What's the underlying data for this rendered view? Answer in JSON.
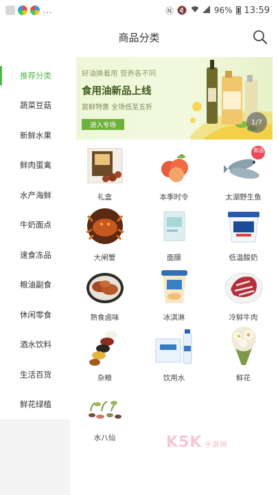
{
  "status_bar": {
    "battery": "96%",
    "time": "13:59",
    "more": "..."
  },
  "header": {
    "title": "商品分类"
  },
  "sidebar": {
    "items": [
      {
        "label": "推荐分类",
        "active": true
      },
      {
        "label": "蔬菜豆菇"
      },
      {
        "label": "新鲜水果"
      },
      {
        "label": "鲜肉蛋禽"
      },
      {
        "label": "水产海鲜"
      },
      {
        "label": "牛奶面点"
      },
      {
        "label": "速食冻品"
      },
      {
        "label": "粮油副食"
      },
      {
        "label": "休闲零食"
      },
      {
        "label": "酒水饮料"
      },
      {
        "label": "生活百货"
      },
      {
        "label": "鲜花绿植"
      }
    ]
  },
  "banner": {
    "subtitle": "好油换着用 营养各不同",
    "title": "食用油新品上线",
    "desc": "尝鲜特惠 全场低至五折",
    "button": "进入专场",
    "pager": "1/7"
  },
  "products": [
    {
      "label": "礼盒",
      "icon": "gift-box-icon"
    },
    {
      "label": "本季时令",
      "icon": "apple-icon"
    },
    {
      "label": "太湖野生鱼",
      "icon": "fish-icon",
      "badge": "新品"
    },
    {
      "label": "大闸蟹",
      "icon": "crab-icon"
    },
    {
      "label": "面膜",
      "icon": "face-mask-icon"
    },
    {
      "label": "低温酸奶",
      "icon": "yogurt-icon"
    },
    {
      "label": "熟食卤味",
      "icon": "braised-meat-icon"
    },
    {
      "label": "冰淇淋",
      "icon": "ice-cream-icon"
    },
    {
      "label": "冷鲜牛肉",
      "icon": "beef-icon"
    },
    {
      "label": "杂粮",
      "icon": "grains-icon"
    },
    {
      "label": "饮用水",
      "icon": "water-bottle-icon"
    },
    {
      "label": "鲜花",
      "icon": "flower-bouquet-icon"
    },
    {
      "label": "水八仙",
      "icon": "aquatic-vegetables-icon"
    }
  ],
  "watermark": {
    "text": "K5K",
    "sub": "手游网"
  },
  "colors": {
    "accent": "#4cb84a",
    "sidebar_bg": "#f4f4f4"
  }
}
